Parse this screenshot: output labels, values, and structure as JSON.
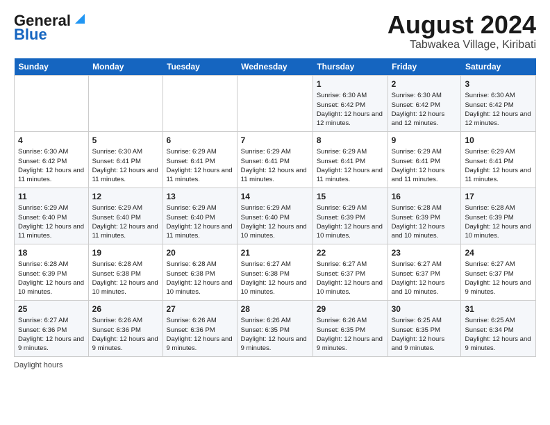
{
  "header": {
    "logo_line1": "General",
    "logo_line2": "Blue",
    "title": "August 2024",
    "subtitle": "Tabwakea Village, Kiribati"
  },
  "weekdays": [
    "Sunday",
    "Monday",
    "Tuesday",
    "Wednesday",
    "Thursday",
    "Friday",
    "Saturday"
  ],
  "weeks": [
    [
      {
        "day": "",
        "info": ""
      },
      {
        "day": "",
        "info": ""
      },
      {
        "day": "",
        "info": ""
      },
      {
        "day": "",
        "info": ""
      },
      {
        "day": "1",
        "info": "Sunrise: 6:30 AM\nSunset: 6:42 PM\nDaylight: 12 hours and 12 minutes."
      },
      {
        "day": "2",
        "info": "Sunrise: 6:30 AM\nSunset: 6:42 PM\nDaylight: 12 hours and 12 minutes."
      },
      {
        "day": "3",
        "info": "Sunrise: 6:30 AM\nSunset: 6:42 PM\nDaylight: 12 hours and 12 minutes."
      }
    ],
    [
      {
        "day": "4",
        "info": "Sunrise: 6:30 AM\nSunset: 6:42 PM\nDaylight: 12 hours and 11 minutes."
      },
      {
        "day": "5",
        "info": "Sunrise: 6:30 AM\nSunset: 6:41 PM\nDaylight: 12 hours and 11 minutes."
      },
      {
        "day": "6",
        "info": "Sunrise: 6:29 AM\nSunset: 6:41 PM\nDaylight: 12 hours and 11 minutes."
      },
      {
        "day": "7",
        "info": "Sunrise: 6:29 AM\nSunset: 6:41 PM\nDaylight: 12 hours and 11 minutes."
      },
      {
        "day": "8",
        "info": "Sunrise: 6:29 AM\nSunset: 6:41 PM\nDaylight: 12 hours and 11 minutes."
      },
      {
        "day": "9",
        "info": "Sunrise: 6:29 AM\nSunset: 6:41 PM\nDaylight: 12 hours and 11 minutes."
      },
      {
        "day": "10",
        "info": "Sunrise: 6:29 AM\nSunset: 6:41 PM\nDaylight: 12 hours and 11 minutes."
      }
    ],
    [
      {
        "day": "11",
        "info": "Sunrise: 6:29 AM\nSunset: 6:40 PM\nDaylight: 12 hours and 11 minutes."
      },
      {
        "day": "12",
        "info": "Sunrise: 6:29 AM\nSunset: 6:40 PM\nDaylight: 12 hours and 11 minutes."
      },
      {
        "day": "13",
        "info": "Sunrise: 6:29 AM\nSunset: 6:40 PM\nDaylight: 12 hours and 11 minutes."
      },
      {
        "day": "14",
        "info": "Sunrise: 6:29 AM\nSunset: 6:40 PM\nDaylight: 12 hours and 10 minutes."
      },
      {
        "day": "15",
        "info": "Sunrise: 6:29 AM\nSunset: 6:39 PM\nDaylight: 12 hours and 10 minutes."
      },
      {
        "day": "16",
        "info": "Sunrise: 6:28 AM\nSunset: 6:39 PM\nDaylight: 12 hours and 10 minutes."
      },
      {
        "day": "17",
        "info": "Sunrise: 6:28 AM\nSunset: 6:39 PM\nDaylight: 12 hours and 10 minutes."
      }
    ],
    [
      {
        "day": "18",
        "info": "Sunrise: 6:28 AM\nSunset: 6:39 PM\nDaylight: 12 hours and 10 minutes."
      },
      {
        "day": "19",
        "info": "Sunrise: 6:28 AM\nSunset: 6:38 PM\nDaylight: 12 hours and 10 minutes."
      },
      {
        "day": "20",
        "info": "Sunrise: 6:28 AM\nSunset: 6:38 PM\nDaylight: 12 hours and 10 minutes."
      },
      {
        "day": "21",
        "info": "Sunrise: 6:27 AM\nSunset: 6:38 PM\nDaylight: 12 hours and 10 minutes."
      },
      {
        "day": "22",
        "info": "Sunrise: 6:27 AM\nSunset: 6:37 PM\nDaylight: 12 hours and 10 minutes."
      },
      {
        "day": "23",
        "info": "Sunrise: 6:27 AM\nSunset: 6:37 PM\nDaylight: 12 hours and 10 minutes."
      },
      {
        "day": "24",
        "info": "Sunrise: 6:27 AM\nSunset: 6:37 PM\nDaylight: 12 hours and 9 minutes."
      }
    ],
    [
      {
        "day": "25",
        "info": "Sunrise: 6:27 AM\nSunset: 6:36 PM\nDaylight: 12 hours and 9 minutes."
      },
      {
        "day": "26",
        "info": "Sunrise: 6:26 AM\nSunset: 6:36 PM\nDaylight: 12 hours and 9 minutes."
      },
      {
        "day": "27",
        "info": "Sunrise: 6:26 AM\nSunset: 6:36 PM\nDaylight: 12 hours and 9 minutes."
      },
      {
        "day": "28",
        "info": "Sunrise: 6:26 AM\nSunset: 6:35 PM\nDaylight: 12 hours and 9 minutes."
      },
      {
        "day": "29",
        "info": "Sunrise: 6:26 AM\nSunset: 6:35 PM\nDaylight: 12 hours and 9 minutes."
      },
      {
        "day": "30",
        "info": "Sunrise: 6:25 AM\nSunset: 6:35 PM\nDaylight: 12 hours and 9 minutes."
      },
      {
        "day": "31",
        "info": "Sunrise: 6:25 AM\nSunset: 6:34 PM\nDaylight: 12 hours and 9 minutes."
      }
    ]
  ],
  "legend": {
    "daylight_label": "Daylight hours"
  }
}
